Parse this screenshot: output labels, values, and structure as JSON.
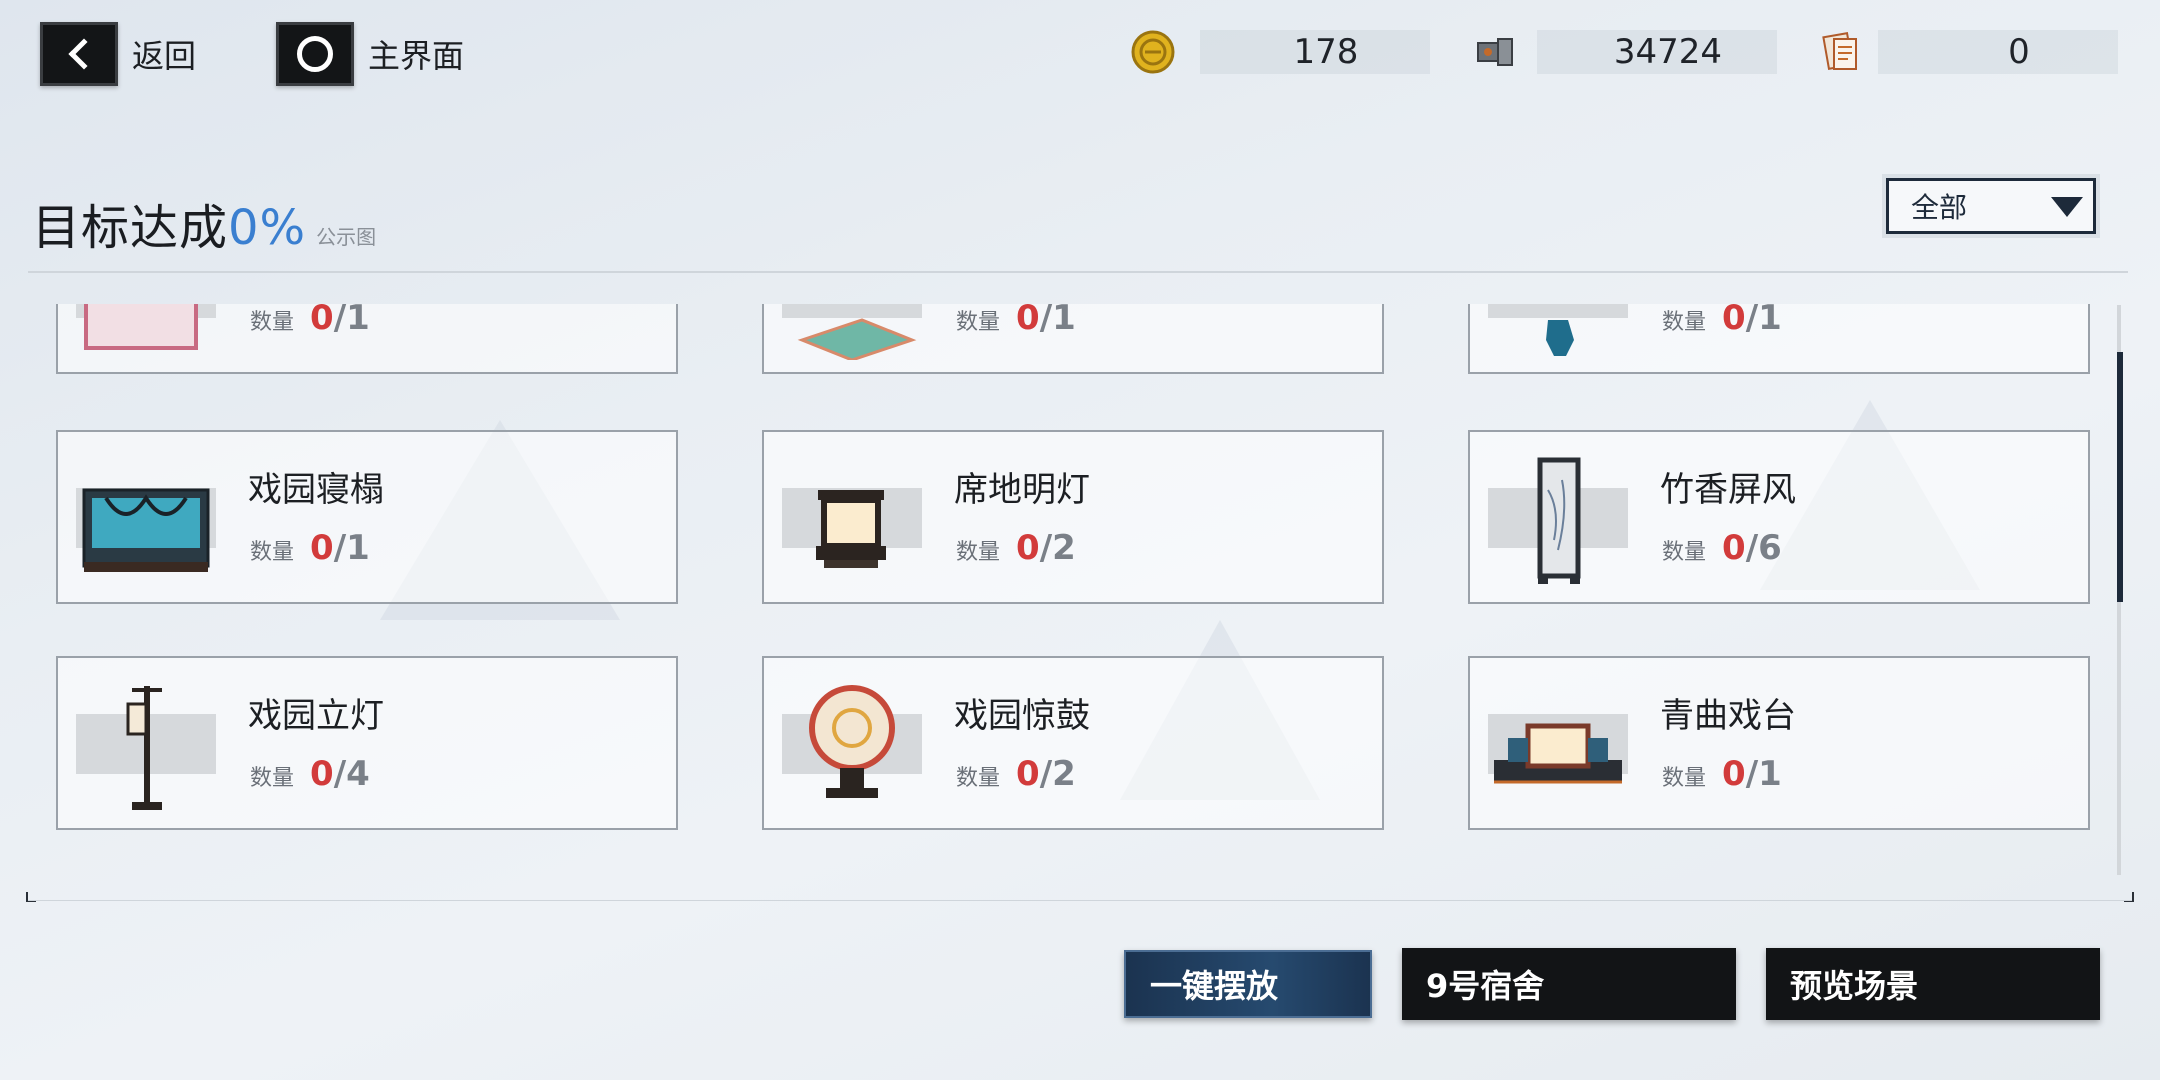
{
  "topbar": {
    "back_label": "返回",
    "home_label": "主界面"
  },
  "resources": [
    {
      "icon": "gold-coin-icon",
      "value": "178"
    },
    {
      "icon": "parts-icon",
      "value": "34724"
    },
    {
      "icon": "document-icon",
      "value": "0"
    }
  ],
  "header": {
    "title": "目标达成",
    "percent": "0%",
    "subtitle": "公示图",
    "filter_value": "全部"
  },
  "qty_label": "数量",
  "items_partial": [
    {
      "name": "",
      "have": "0",
      "need": "/1",
      "icon": "pink-panel-icon"
    },
    {
      "name": "",
      "have": "0",
      "need": "/1",
      "icon": "carpet-icon"
    },
    {
      "name": "",
      "have": "0",
      "need": "/1",
      "icon": "blue-ornament-icon"
    }
  ],
  "items": [
    {
      "name": "戏园寝榻",
      "have": "0",
      "need": "/1",
      "icon": "bed-icon"
    },
    {
      "name": "席地明灯",
      "have": "0",
      "need": "/2",
      "icon": "floor-lamp-icon"
    },
    {
      "name": "竹香屏风",
      "have": "0",
      "need": "/6",
      "icon": "folding-screen-icon"
    },
    {
      "name": "戏园立灯",
      "have": "0",
      "need": "/4",
      "icon": "standing-lantern-icon"
    },
    {
      "name": "戏园惊鼓",
      "have": "0",
      "need": "/2",
      "icon": "drum-icon"
    },
    {
      "name": "青曲戏台",
      "have": "0",
      "need": "/1",
      "icon": "stage-icon"
    }
  ],
  "buttons": {
    "place_all": "一键摆放",
    "dorm": "9号宿舍",
    "preview": "预览场景"
  },
  "colors": {
    "accent_blue": "#3a7fd0",
    "qty_red": "#d23b3b",
    "dark": "#121416"
  }
}
